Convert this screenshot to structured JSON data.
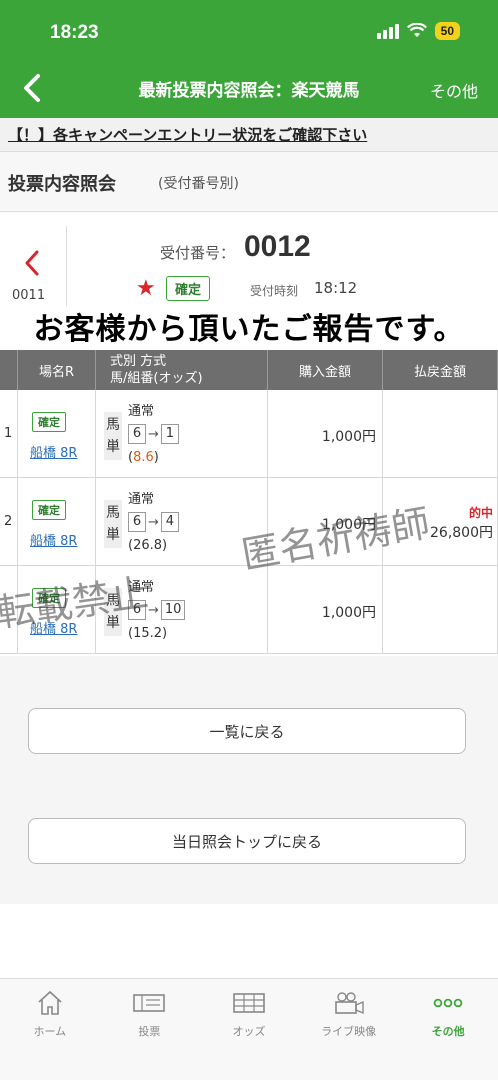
{
  "status_bar": {
    "time": "18:23",
    "battery": "50"
  },
  "nav": {
    "title": "最新投票内容照会：楽天競馬",
    "other": "その他"
  },
  "notice": {
    "text": "【！】各キャンペーンエントリー状況をご確認下さい"
  },
  "section": {
    "title": "投票内容照会",
    "subtitle": "(受付番号別)"
  },
  "receipt": {
    "prev_number": "0011",
    "label": "受付番号：",
    "number": "0012",
    "status": "確定",
    "time_label": "受付時刻",
    "time_value": "18:12"
  },
  "overlay_text": "お客様から頂いたご報告です。",
  "table": {
    "headers": {
      "venue": "場名R",
      "type_line1": "式別 方式",
      "type_line2": "馬/組番(オッズ)",
      "amount": "購入金額",
      "payout": "払戻金額"
    },
    "rows": [
      {
        "no": "1",
        "status": "確定",
        "race": "船橋 8R",
        "bet_type": "馬単",
        "method": "通常",
        "first": "6",
        "second": "1",
        "odds_open": "(",
        "odds": "8.6",
        "odds_close": ")",
        "amount": "1,000円",
        "hit": "",
        "payout": ""
      },
      {
        "no": "2",
        "status": "確定",
        "race": "船橋 8R",
        "bet_type": "馬単",
        "method": "通常",
        "first": "6",
        "second": "4",
        "odds_open": "(",
        "odds": "26.8",
        "odds_close": ")",
        "amount": "1,000円",
        "hit": "的中",
        "payout": "26,800円"
      },
      {
        "no": "",
        "status": "確定",
        "race": "船橋 8R",
        "bet_type": "馬単",
        "method": "通常",
        "first": "6",
        "second": "10",
        "odds_open": "(",
        "odds": "15.2",
        "odds_close": ")",
        "amount": "1,000円",
        "hit": "",
        "payout": ""
      }
    ]
  },
  "watermarks": {
    "w1": "匿名祈祷師",
    "w2": "転載禁止"
  },
  "buttons": {
    "back_to_list": "一覧に戻る",
    "back_to_top": "当日照会トップに戻る"
  },
  "tabs": [
    {
      "label": "ホーム",
      "icon": "home-icon"
    },
    {
      "label": "投票",
      "icon": "ticket-icon"
    },
    {
      "label": "オッズ",
      "icon": "odds-table-icon"
    },
    {
      "label": "ライブ映像",
      "icon": "video-camera-icon"
    },
    {
      "label": "その他",
      "icon": "more-dots-icon"
    }
  ],
  "colors": {
    "brand_green": "#3ca53a",
    "hit_red": "#d9262b",
    "odds_orange": "#e05a0b",
    "link_blue": "#2a6fb7"
  }
}
